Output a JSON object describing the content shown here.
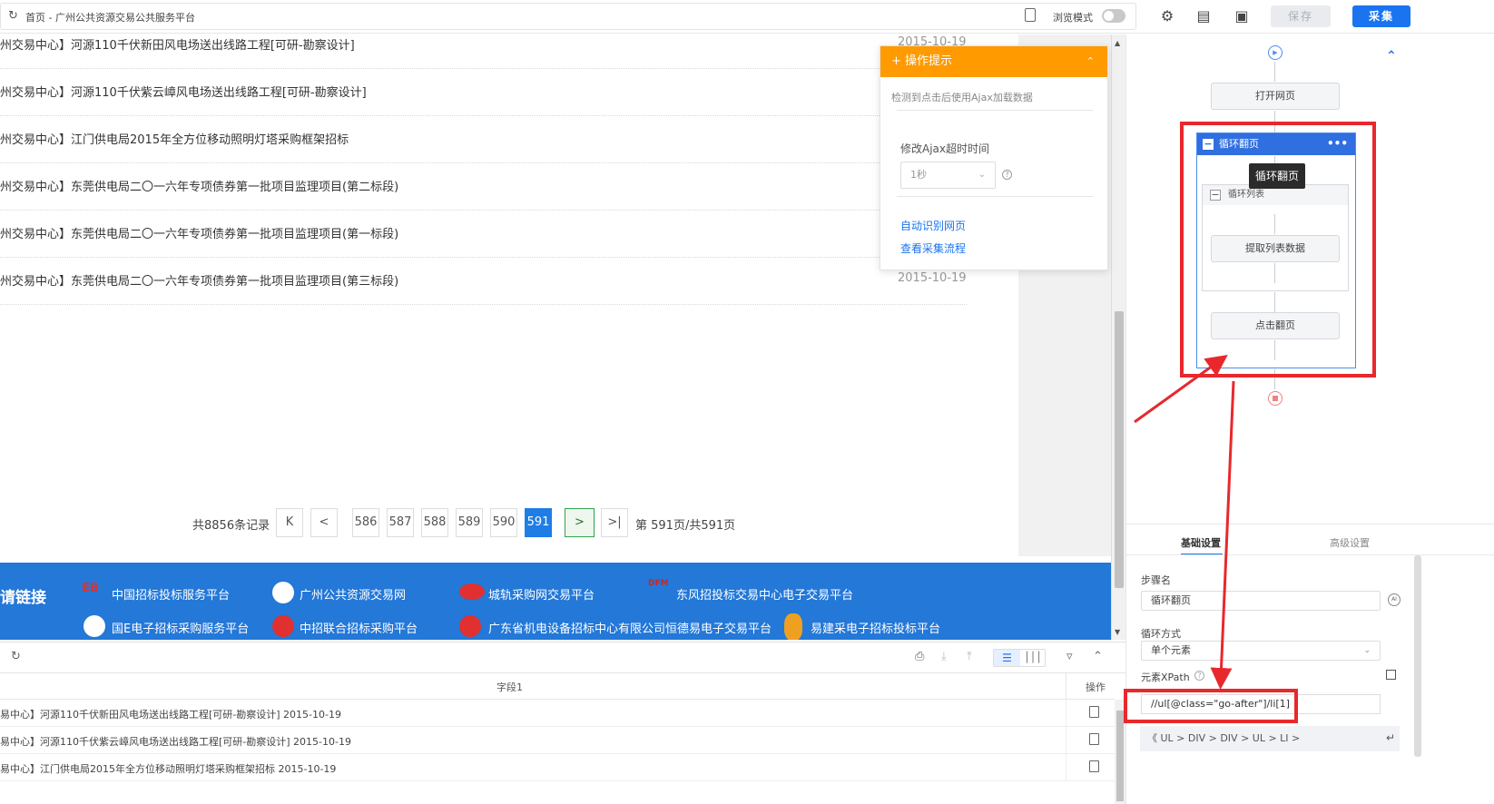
{
  "browser": {
    "page_title": "首页 - 广州公共资源交易公共服务平台",
    "browse_mode_label": "浏览模式"
  },
  "toolbar": {
    "save_label": "保存",
    "collect_label": "采集"
  },
  "list": [
    {
      "title": "州交易中心】河源110千伏新田风电场送出线路工程[可研-勘察设计]",
      "date": "2015-10-19"
    },
    {
      "title": "州交易中心】河源110千伏紫云嶂风电场送出线路工程[可研-勘察设计]",
      "date": ""
    },
    {
      "title": "州交易中心】江门供电局2015年全方位移动照明灯塔采购框架招标",
      "date": ""
    },
    {
      "title": "州交易中心】东莞供电局二〇一六年专项债券第一批项目监理项目(第二标段)",
      "date": ""
    },
    {
      "title": "州交易中心】东莞供电局二〇一六年专项债券第一批项目监理项目(第一标段)",
      "date": ""
    },
    {
      "title": "州交易中心】东莞供电局二〇一六年专项债券第一批项目监理项目(第三标段)",
      "date": "2015-10-19"
    }
  ],
  "pager": {
    "total": "共8856条记录",
    "first": "K",
    "prev": "<",
    "pages": [
      "586",
      "587",
      "588",
      "589",
      "590",
      "591"
    ],
    "next": ">",
    "last": ">|",
    "info": "第 591页/共591页"
  },
  "friendly_links": {
    "heading": "请链接",
    "links": [
      "中国招标投标服务平台",
      "广州公共资源交易网",
      "城轨采购网交易平台",
      "东风招投标交易中心电子交易平台",
      "国E电子招标采购服务平台",
      "中招联合招标采购平台",
      "广东省机电设备招标中心有限公司恒德易电子交易平台",
      "易建采电子招标投标平台"
    ]
  },
  "tips": {
    "header": "操作提示",
    "message": "检测到点击后使用Ajax加载数据",
    "ajax_label": "修改Ajax超时时间",
    "ajax_value": "1秒",
    "link_auto": "自动识别网页",
    "link_flow": "查看采集流程"
  },
  "datatable": {
    "col_field": "字段1",
    "col_op": "操作",
    "rows": [
      "易中心】河源110千伏新田风电场送出线路工程[可研-勘察设计] 2015-10-19",
      "易中心】河源110千伏紫云嶂风电场送出线路工程[可研-勘察设计] 2015-10-19",
      "易中心】江门供电局2015年全方位移动照明灯塔采购框架招标 2015-10-19"
    ]
  },
  "workflow": {
    "open_page": "打开网页",
    "loop_page": "循环翻页",
    "loop_list": "循环列表",
    "extract": "提取列表数据",
    "click_next": "点击翻页",
    "tooltip": "循环翻页"
  },
  "settings": {
    "tab_basic": "基础设置",
    "tab_advanced": "高级设置",
    "step_name_label": "步骤名",
    "step_name_value": "循环翻页",
    "loop_mode_label": "循环方式",
    "loop_mode_value": "单个元素",
    "xpath_label": "元素XPath",
    "xpath_value": "//ul[@class=\"go-after\"]/li[1]",
    "crumbs": "《  UL  >  DIV  >  DIV  >  UL  >  LI  >"
  },
  "colors": {
    "accent_blue": "#1a74f0",
    "tips_orange": "#ff9a00",
    "annotation_red": "#e8282d",
    "links_bar_blue": "#2378d8"
  }
}
